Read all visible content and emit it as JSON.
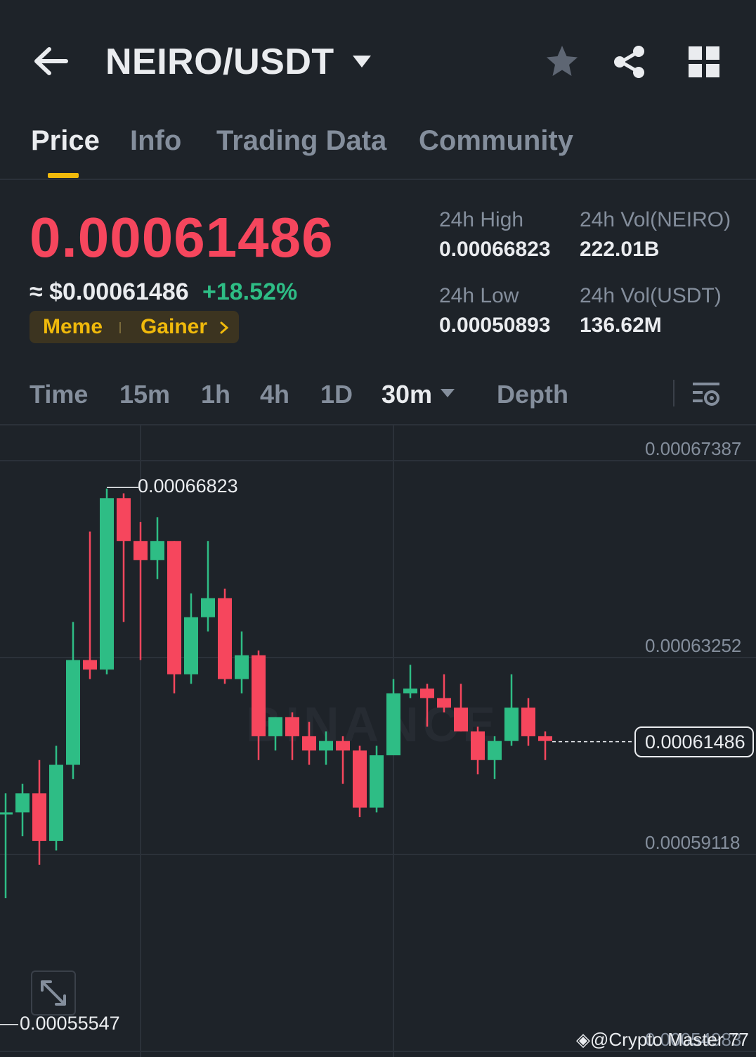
{
  "header": {
    "pair": "NEIRO/USDT",
    "icons": [
      "back-arrow-icon",
      "dropdown-caret-icon",
      "star-icon",
      "share-icon",
      "grid-icon"
    ]
  },
  "tabs": [
    {
      "label": "Price",
      "active": true
    },
    {
      "label": "Info",
      "active": false
    },
    {
      "label": "Trading Data",
      "active": false
    },
    {
      "label": "Community",
      "active": false
    }
  ],
  "price": {
    "last": "0.00061486",
    "usd": "≈ $0.00061486",
    "change": "+18.52%",
    "tags": [
      "Meme",
      "Gainer"
    ]
  },
  "stats": {
    "high_label": "24h High",
    "high_value": "0.00066823",
    "low_label": "24h Low",
    "low_value": "0.00050893",
    "vol_base_label": "24h Vol(NEIRO)",
    "vol_base_value": "222.01B",
    "vol_quote_label": "24h Vol(USDT)",
    "vol_quote_value": "136.62M"
  },
  "timeframes": {
    "items": [
      "Time",
      "15m",
      "1h",
      "4h",
      "1D",
      "30m",
      "Depth"
    ],
    "active": "30m"
  },
  "colors": {
    "up": "#2ebd85",
    "down": "#f6465d",
    "accent": "#f0b90b",
    "background": "#1e2329"
  },
  "chart_data": {
    "type": "candlestick",
    "y_axis_ticks": [
      "0.00067387",
      "0.00063252",
      "0.00059118",
      "0.00054983"
    ],
    "ylim": [
      0.00054983,
      0.00067387
    ],
    "current_price": "0.00061486",
    "high_marker": "0.00066823",
    "low_marker": "0.00055547",
    "watermark": "BINANCE",
    "candles": [
      {
        "o": 0.0006,
        "h": 0.000604,
        "l": 0.000582,
        "c": 0.0006
      },
      {
        "o": 0.0006,
        "h": 0.000606,
        "l": 0.000595,
        "c": 0.000604
      },
      {
        "o": 0.000604,
        "h": 0.000611,
        "l": 0.000589,
        "c": 0.000594
      },
      {
        "o": 0.000594,
        "h": 0.000614,
        "l": 0.000592,
        "c": 0.00061
      },
      {
        "o": 0.00061,
        "h": 0.00064,
        "l": 0.000607,
        "c": 0.000632
      },
      {
        "o": 0.000632,
        "h": 0.000659,
        "l": 0.000628,
        "c": 0.00063
      },
      {
        "o": 0.00063,
        "h": 0.000668,
        "l": 0.000629,
        "c": 0.000666
      },
      {
        "o": 0.000666,
        "h": 0.000667,
        "l": 0.00064,
        "c": 0.000657
      },
      {
        "o": 0.000657,
        "h": 0.000661,
        "l": 0.000632,
        "c": 0.000653
      },
      {
        "o": 0.000653,
        "h": 0.000662,
        "l": 0.000649,
        "c": 0.000657
      },
      {
        "o": 0.000657,
        "h": 0.000657,
        "l": 0.000625,
        "c": 0.000629
      },
      {
        "o": 0.000629,
        "h": 0.000646,
        "l": 0.000627,
        "c": 0.000641
      },
      {
        "o": 0.000641,
        "h": 0.000657,
        "l": 0.000638,
        "c": 0.000645
      },
      {
        "o": 0.000645,
        "h": 0.000647,
        "l": 0.000627,
        "c": 0.000628
      },
      {
        "o": 0.000628,
        "h": 0.000638,
        "l": 0.000625,
        "c": 0.000633
      },
      {
        "o": 0.000633,
        "h": 0.000634,
        "l": 0.000611,
        "c": 0.000616
      },
      {
        "o": 0.000616,
        "h": 0.00062,
        "l": 0.000613,
        "c": 0.00062
      },
      {
        "o": 0.00062,
        "h": 0.000621,
        "l": 0.000611,
        "c": 0.000616
      },
      {
        "o": 0.000616,
        "h": 0.000619,
        "l": 0.00061,
        "c": 0.000613
      },
      {
        "o": 0.000613,
        "h": 0.000617,
        "l": 0.00061,
        "c": 0.000615
      },
      {
        "o": 0.000615,
        "h": 0.000616,
        "l": 0.000606,
        "c": 0.000613
      },
      {
        "o": 0.000613,
        "h": 0.000614,
        "l": 0.000599,
        "c": 0.000601
      },
      {
        "o": 0.000601,
        "h": 0.000614,
        "l": 0.0006,
        "c": 0.000612
      },
      {
        "o": 0.000612,
        "h": 0.000628,
        "l": 0.000612,
        "c": 0.000625
      },
      {
        "o": 0.000625,
        "h": 0.000631,
        "l": 0.000624,
        "c": 0.000626
      },
      {
        "o": 0.000626,
        "h": 0.000627,
        "l": 0.000618,
        "c": 0.000624
      },
      {
        "o": 0.000624,
        "h": 0.000629,
        "l": 0.000621,
        "c": 0.000622
      },
      {
        "o": 0.000622,
        "h": 0.000627,
        "l": 0.000617,
        "c": 0.000617
      },
      {
        "o": 0.000617,
        "h": 0.000618,
        "l": 0.000608,
        "c": 0.000611
      },
      {
        "o": 0.000611,
        "h": 0.000616,
        "l": 0.000607,
        "c": 0.000615
      },
      {
        "o": 0.000615,
        "h": 0.000629,
        "l": 0.000614,
        "c": 0.000622
      },
      {
        "o": 0.000622,
        "h": 0.000624,
        "l": 0.000614,
        "c": 0.000616
      },
      {
        "o": 0.000616,
        "h": 0.000617,
        "l": 0.000611,
        "c": 0.000615
      }
    ]
  },
  "credit": "@Crypto Master 77"
}
